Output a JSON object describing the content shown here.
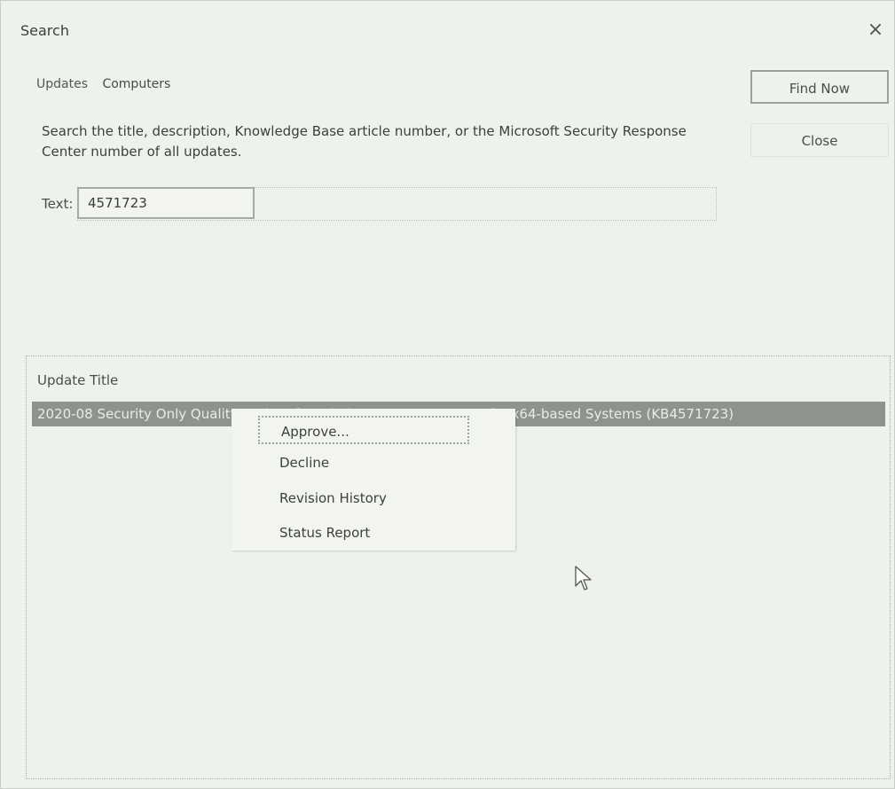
{
  "window": {
    "title": "Search",
    "close_glyph": "×",
    "close_icon": "close-icon"
  },
  "tabs": [
    {
      "label": "Updates",
      "active": true
    },
    {
      "label": "Computers",
      "active": false
    }
  ],
  "buttons": {
    "find_now": "Find Now",
    "close": "Close"
  },
  "description": "Search the title, description, Knowledge Base article number, or the Microsoft Security Response Center number of all updates.",
  "search": {
    "label": "Text:",
    "value": "4571723"
  },
  "results": {
    "column_header": "Update Title",
    "rows": [
      {
        "title": "2020-08 Security Only Quality Update for Windows Server 2012 R2 for x64-based Systems (KB4571723)",
        "selected": true
      }
    ]
  },
  "context_menu": {
    "items": [
      "Approve...",
      "Decline",
      "Revision History",
      "Status Report"
    ],
    "focused_index": 0
  },
  "colors": {
    "selection_bg": "#8f938e",
    "dialog_bg": "#eef2ec"
  }
}
